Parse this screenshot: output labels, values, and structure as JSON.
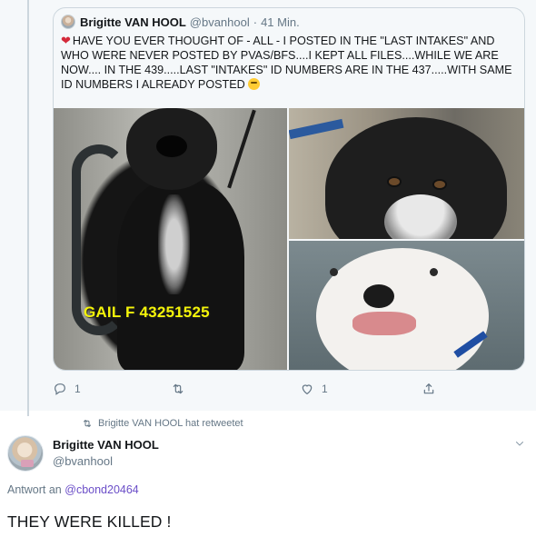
{
  "quoted_tweet": {
    "author_name": "Brigitte VAN HOOL",
    "author_handle": "@bvanhool",
    "separator": "·",
    "time": "41 Min.",
    "text": "HAVE YOU EVER THOUGHT OF - ALL - I POSTED IN THE \"LAST INTAKES\" AND WHO WERE NEVER POSTED BY PVAS/BFS....I KEPT ALL FILES....WHILE WE ARE NOW.... IN THE 439.....LAST \"INTAKES\" ID NUMBERS ARE IN THE 437.....WITH SAME ID NUMBERS I ALREADY POSTED",
    "leading_emoji_icon": "broken-heart-icon",
    "trailing_emoji_icon": "thinking-face-icon",
    "photo_caption": "GAIL F 43251525",
    "reply_count": "1",
    "retweet_count": "",
    "like_count": "1"
  },
  "retweet_notice": "Brigitte VAN HOOL hat retweetet",
  "tweet": {
    "author_name": "Brigitte VAN HOOL",
    "author_handle": "@bvanhool",
    "reply_prefix": "Antwort an",
    "reply_target": "@cbond20464",
    "text": "THEY WERE KILLED !"
  },
  "colors": {
    "background_muted": "#f5f8fa",
    "secondary_text": "#657786",
    "link": "#6b4ec8",
    "caption_yellow": "#f4f409"
  }
}
